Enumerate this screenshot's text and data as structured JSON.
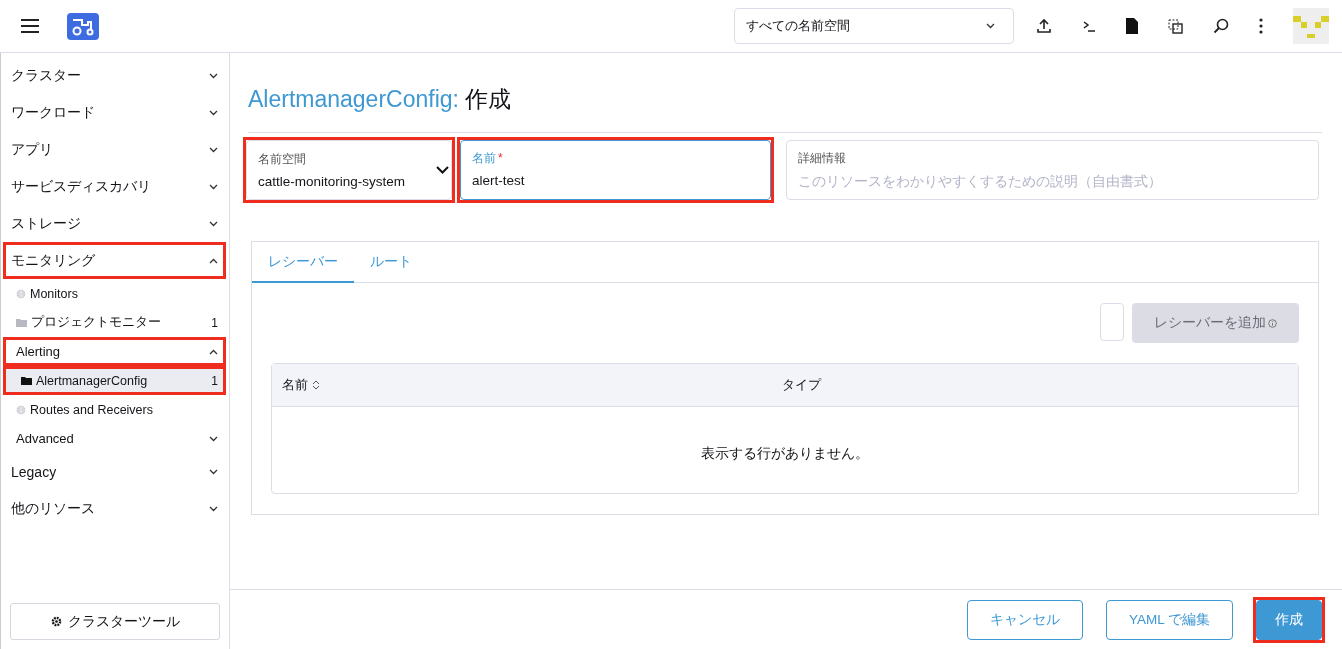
{
  "header": {
    "namespace_filter": "すべての名前空間"
  },
  "sidebar": {
    "items": [
      {
        "kind": "group",
        "label": "クラスター",
        "expanded": false,
        "highlighted": false
      },
      {
        "kind": "group",
        "label": "ワークロード",
        "expanded": false,
        "highlighted": false
      },
      {
        "kind": "group",
        "label": "アプリ",
        "expanded": false,
        "highlighted": false
      },
      {
        "kind": "group",
        "label": "サービスディスカバリ",
        "expanded": false,
        "highlighted": false
      },
      {
        "kind": "group",
        "label": "ストレージ",
        "expanded": false,
        "highlighted": false
      },
      {
        "kind": "group",
        "label": "モニタリング",
        "expanded": true,
        "highlighted": true,
        "children": [
          {
            "kind": "page",
            "label": "Monitors",
            "selected": false,
            "highlighted": false
          },
          {
            "kind": "resource",
            "label": "プロジェクトモニター",
            "count": "1",
            "selected": false,
            "highlighted": false
          },
          {
            "kind": "subgroup",
            "label": "Alerting",
            "expanded": true,
            "highlighted": true,
            "children": [
              {
                "kind": "resource",
                "label": "AlertmanagerConfig",
                "count": "1",
                "selected": true,
                "highlighted": true
              },
              {
                "kind": "page",
                "label": "Routes and Receivers",
                "selected": false,
                "highlighted": false
              }
            ]
          },
          {
            "kind": "subgroup",
            "label": "Advanced",
            "expanded": false,
            "highlighted": false
          }
        ]
      },
      {
        "kind": "group",
        "label": "Legacy",
        "expanded": false,
        "highlighted": false
      },
      {
        "kind": "group",
        "label": "他のリソース",
        "expanded": false,
        "highlighted": false
      }
    ],
    "footer_button": "クラスターツール"
  },
  "page": {
    "title_type": "AlertmanagerConfig:",
    "title_action": "作成",
    "namespace": {
      "label": "名前空間",
      "value": "cattle-monitoring-system",
      "highlighted": true
    },
    "name": {
      "label": "名前",
      "required_mark": "*",
      "value": "alert-test",
      "highlighted": true
    },
    "description": {
      "label": "詳細情報",
      "placeholder": "このリソースをわかりやすくするための説明（自由書式）"
    },
    "tabs": [
      {
        "label": "レシーバー",
        "selected": true
      },
      {
        "label": "ルート",
        "selected": false
      }
    ],
    "select_checkbox": {
      "checked": false
    },
    "add_button": {
      "label": "レシーバーを追加",
      "disabled": true
    },
    "table": {
      "columns": [
        "名前",
        "タイプ"
      ],
      "empty_message": "表示する行がありません。"
    }
  },
  "footer": {
    "buttons": [
      {
        "kind": "secondary",
        "label": "キャンセル",
        "highlighted": false
      },
      {
        "kind": "secondary",
        "label": "YAML で編集",
        "highlighted": false
      },
      {
        "kind": "primary",
        "label": "作成",
        "highlighted": true
      }
    ]
  }
}
